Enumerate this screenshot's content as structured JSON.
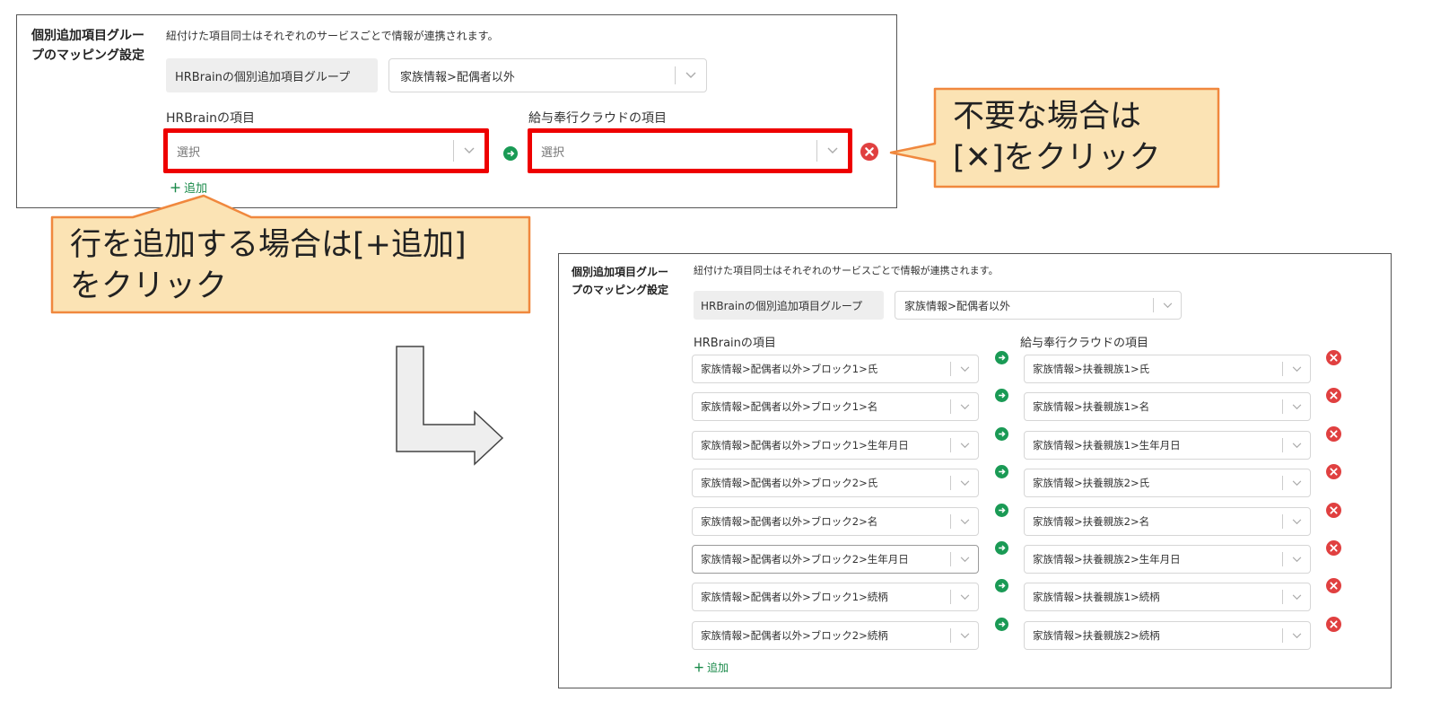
{
  "colors": {
    "accent_green": "#1a9a55",
    "remove_red": "#e04040",
    "highlight_red": "#ee0000",
    "callout_fill": "#fbe3b4",
    "callout_border": "#f0883e"
  },
  "panel": {
    "label_line1": "個別追加項目グルー",
    "label_line2": "プのマッピング設定",
    "description": "紐付けた項目同士はそれぞれのサービスごとで情報が連携されます。",
    "group_label": "HRBrainの個別追加項目グループ",
    "group_value": "家族情報>配偶者以外",
    "col_hrbrain": "HRBrainの項目",
    "col_kyuyo": "給与奉行クラウドの項目",
    "add_label": "追加"
  },
  "top_row": {
    "left_placeholder": "選択",
    "right_placeholder": "選択"
  },
  "rows": [
    {
      "left": "家族情報>配偶者以外>ブロック1>氏",
      "right": "家族情報>扶養親族1>氏"
    },
    {
      "left": "家族情報>配偶者以外>ブロック1>名",
      "right": "家族情報>扶養親族1>名"
    },
    {
      "left": "家族情報>配偶者以外>ブロック1>生年月日",
      "right": "家族情報>扶養親族1>生年月日"
    },
    {
      "left": "家族情報>配偶者以外>ブロック2>氏",
      "right": "家族情報>扶養親族2>氏"
    },
    {
      "left": "家族情報>配偶者以外>ブロック2>名",
      "right": "家族情報>扶養親族2>名"
    },
    {
      "left": "家族情報>配偶者以外>ブロック2>生年月日",
      "right": "家族情報>扶養親族2>生年月日"
    },
    {
      "left": "家族情報>配偶者以外>ブロック1>続柄",
      "right": "家族情報>扶養親族1>続柄"
    },
    {
      "left": "家族情報>配偶者以外>ブロック2>続柄",
      "right": "家族情報>扶養親族2>続柄"
    }
  ],
  "callouts": {
    "remove_line1": "不要な場合は",
    "remove_line2": "[✕]をクリック",
    "add_line1": "行を追加する場合は[+追加]",
    "add_line2": "をクリック"
  }
}
